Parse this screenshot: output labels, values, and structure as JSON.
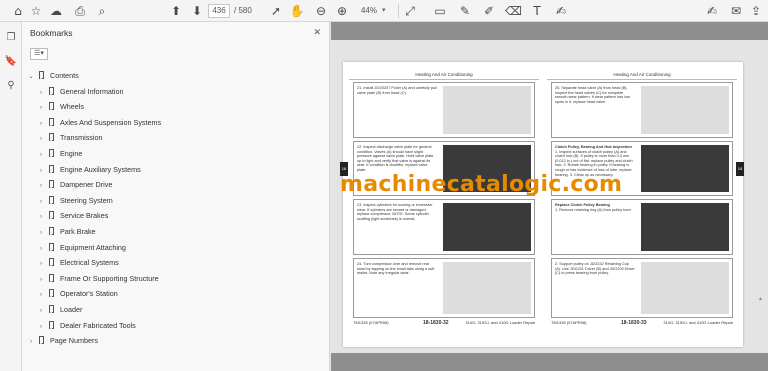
{
  "toolbar": {
    "current_page": "436",
    "total_pages": "/ 580",
    "zoom": "44%"
  },
  "panel": {
    "title": "Bookmarks",
    "close": "✕",
    "options_icon": "options-icon"
  },
  "bookmarks": [
    {
      "label": "Contents",
      "level": 0,
      "expanded": true
    },
    {
      "label": "General Information",
      "level": 1
    },
    {
      "label": "Wheels",
      "level": 1
    },
    {
      "label": "Axles And Suspension Systems",
      "level": 1
    },
    {
      "label": "Transmission",
      "level": 1
    },
    {
      "label": "Engine",
      "level": 1
    },
    {
      "label": "Engine Auxiliary Systems",
      "level": 1
    },
    {
      "label": "Dampener Drive",
      "level": 1
    },
    {
      "label": "Steering System",
      "level": 1
    },
    {
      "label": "Service Brakes",
      "level": 1
    },
    {
      "label": "Park Brake",
      "level": 1
    },
    {
      "label": "Equipment Attaching",
      "level": 1
    },
    {
      "label": "Electrical Systems",
      "level": 1
    },
    {
      "label": "Frame Or Supporting Structure",
      "level": 1
    },
    {
      "label": "Operator's Station",
      "level": 1
    },
    {
      "label": "Loader",
      "level": 1
    },
    {
      "label": "Dealer Fabricated Tools",
      "level": 1
    },
    {
      "label": "Page Numbers",
      "level": 0,
      "expanded": false
    }
  ],
  "document": {
    "header_left": "Heating And Air Conditioning",
    "header_right": "Heating And Air Conditioning",
    "left_rows": [
      {
        "text": "21. Install JDG0207 Puller (A) and carefully pull valve plate (B) from head (C)."
      },
      {
        "text": "22. Inspect discharge valve plate for general condition. Valves (A) should have slight pressure against valve plate. Hold valve plate up to light and verify that valve is against its seat. If condition is doubtful, replace valve plate."
      },
      {
        "text": "23. Inspect cylinders for scoring or excessive wear. If cylinders are scored or damaged, replace compressor. NOTE: Some cylinder scuffing (light scratches) is normal."
      },
      {
        "text": "24. Turn compressor over and remove rear head by tapping on the small tabs using a soft mallet. Note any irregular wear."
      }
    ],
    "right_rows": [
      {
        "title": "",
        "text": "25. Separate head valve (A) from head (B). Inspect the head valves (C) for complete smooth wear pattern. If wear pattern has low spots in it, replace head valve."
      },
      {
        "title": "Clutch Pulley, Bearing And Hub Inspection",
        "text": "1. Inspect surfaces of clutch pulley (A) and clutch hub (B). If pulley is more than 0.3 mm (0.012 in.) out of flat, replace pulley and clutch hub. 2. Rotate bearing in pulley. If bearing is rough or has evidence of loss of lube, replace bearing. 3. Clean up as necessary."
      },
      {
        "title": "Replace Clutch Pulley Bearing",
        "text": "1. Remove retaining ring (A) from pulley bore."
      },
      {
        "title": "",
        "text": "2. Support pulley on JDG232 Retaining Cup (A). Use JDG231 Driver (B) and JDG209 Driver (C) to press bearing from pulley."
      }
    ],
    "footer_left_code": "TM1335 (07APR98)",
    "footer_left_page": "18-1830-32",
    "footer_right_code": "TM1335 (07APR98)",
    "footer_right_page": "18-1830-33",
    "footer_model": "310G, 315SJ, and 410G Loader Repair",
    "watermark": "machinecatalogic.com"
  }
}
